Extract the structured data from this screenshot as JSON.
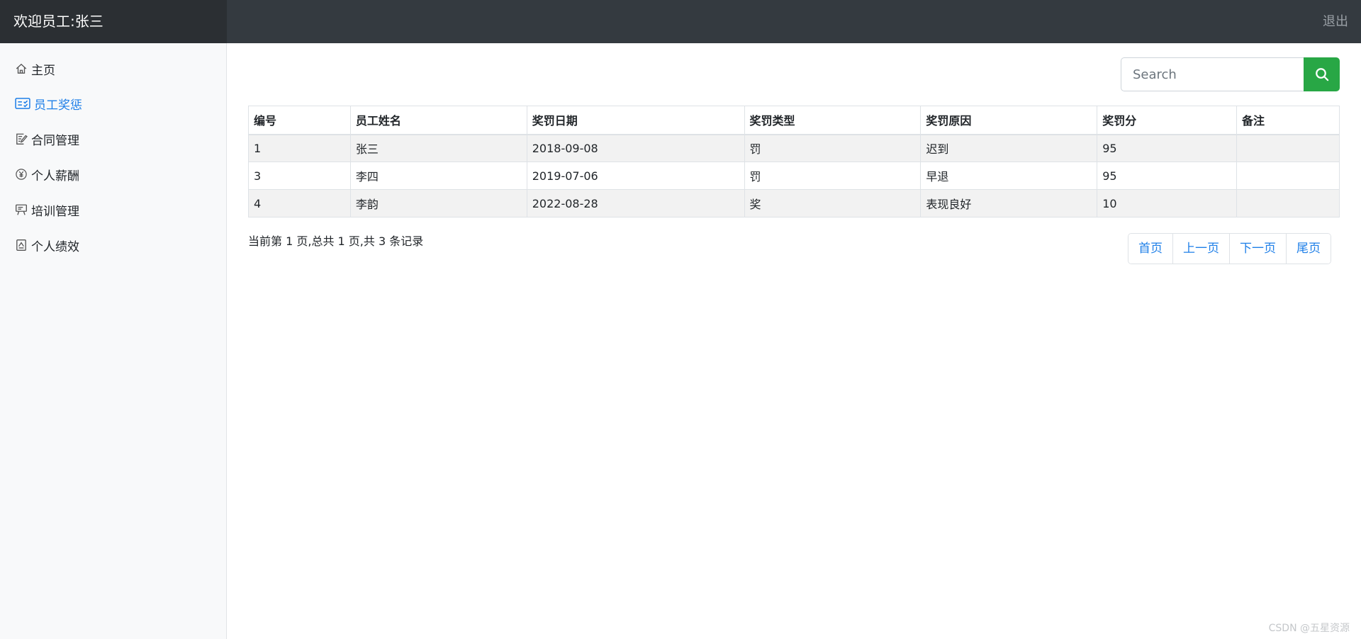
{
  "header": {
    "welcome": "欢迎员工:张三",
    "logout_label": "退出"
  },
  "sidebar": {
    "items": [
      {
        "label": "主页",
        "icon": "home-icon",
        "active": false
      },
      {
        "label": "员工奖惩",
        "icon": "checklist-icon",
        "active": true
      },
      {
        "label": "合同管理",
        "icon": "edit-document-icon",
        "active": false
      },
      {
        "label": "个人薪酬",
        "icon": "yen-circle-icon",
        "active": false
      },
      {
        "label": "培训管理",
        "icon": "presentation-icon",
        "active": false
      },
      {
        "label": "个人绩效",
        "icon": "performance-document-icon",
        "active": false
      }
    ]
  },
  "search": {
    "placeholder": "Search",
    "value": "",
    "button_icon": "search-icon"
  },
  "table": {
    "columns": [
      "编号",
      "员工姓名",
      "奖罚日期",
      "奖罚类型",
      "奖罚原因",
      "奖罚分",
      "备注"
    ],
    "rows": [
      [
        "1",
        "张三",
        "2018-09-08",
        "罚",
        "迟到",
        "95",
        ""
      ],
      [
        "3",
        "李四",
        "2019-07-06",
        "罚",
        "早退",
        "95",
        ""
      ],
      [
        "4",
        "李韵",
        "2022-08-28",
        "奖",
        "表现良好",
        "10",
        ""
      ]
    ]
  },
  "pagination": {
    "info": "当前第 1 页,总共 1 页,共 3 条记录",
    "first": "首页",
    "prev": "上一页",
    "next": "下一页",
    "last": "尾页"
  },
  "watermark": "CSDN @五星资源",
  "colors": {
    "topbar": "#343a40",
    "brand_bg": "#2b2f33",
    "sidebar_bg": "#f8f9fa",
    "active_link": "#1e7fe8",
    "search_button": "#28a745",
    "striped_row": "#f2f2f2"
  }
}
